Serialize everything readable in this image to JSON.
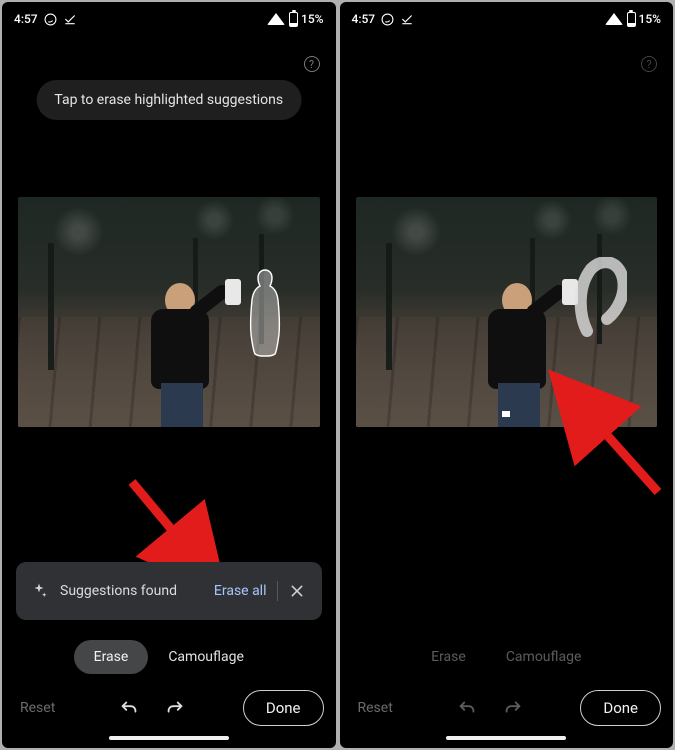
{
  "status": {
    "time": "4:57",
    "battery_text": "15%"
  },
  "left": {
    "tooltip": "Tap to erase highlighted suggestions",
    "suggestion_label": "Suggestions found",
    "erase_all": "Erase all",
    "mode_erase": "Erase",
    "mode_camouflage": "Camouflage",
    "reset": "Reset",
    "done": "Done"
  },
  "right": {
    "mode_erase": "Erase",
    "mode_camouflage": "Camouflage",
    "reset": "Reset",
    "done": "Done"
  }
}
